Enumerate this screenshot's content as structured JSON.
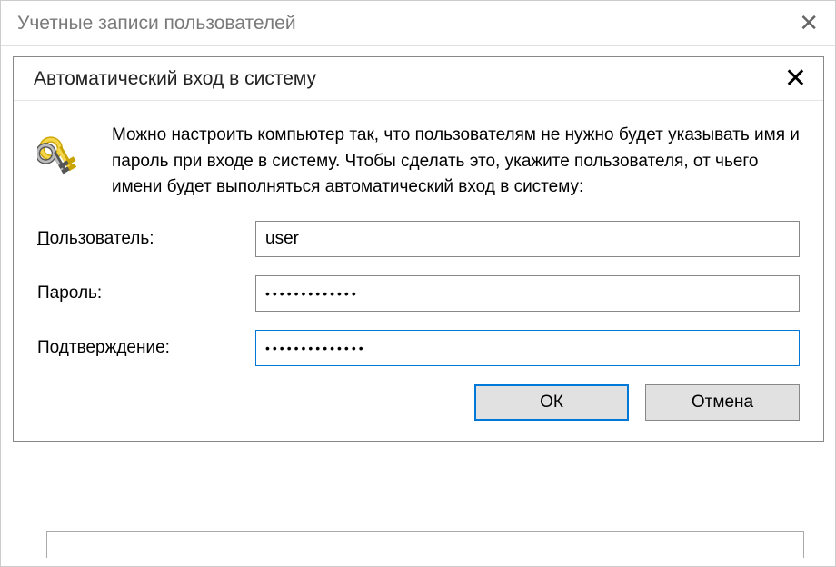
{
  "outerWindow": {
    "title": "Учетные записи пользователей"
  },
  "dialog": {
    "title": "Автоматический вход в систему",
    "description": "Можно настроить компьютер так, что пользователям не нужно будет указывать имя и пароль при входе в систему. Чтобы сделать это, укажите пользователя, от чьего имени будет выполняться автоматический вход в систему:",
    "fields": {
      "user": {
        "label": "Пользователь:",
        "value": "user"
      },
      "password": {
        "label": "Пароль:",
        "value": "•••••••••••••"
      },
      "confirm": {
        "label": "Подтверждение:",
        "value": "••••••••••••••"
      }
    },
    "buttons": {
      "ok": "ОК",
      "cancel": "Отмена"
    }
  }
}
